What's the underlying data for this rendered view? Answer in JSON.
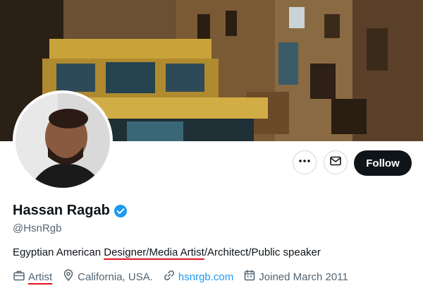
{
  "profile": {
    "name": "Hassan Ragab",
    "handle": "@HsnRgb",
    "bio_parts": {
      "before": "Egyptian American ",
      "highlight": "Designer/Media Artist",
      "after": "/Architect/Public speaker"
    },
    "meta": {
      "profession": "Artist",
      "location": "California, USA.",
      "website": "hsnrgb.com",
      "joined": "Joined March 2011"
    }
  },
  "actions": {
    "more_icon": "ellipsis-icon",
    "message_icon": "envelope-icon",
    "follow_label": "Follow"
  },
  "colors": {
    "accent": "#1d9bf0",
    "underline": "#e0141e",
    "follow_bg": "#0f1419"
  }
}
